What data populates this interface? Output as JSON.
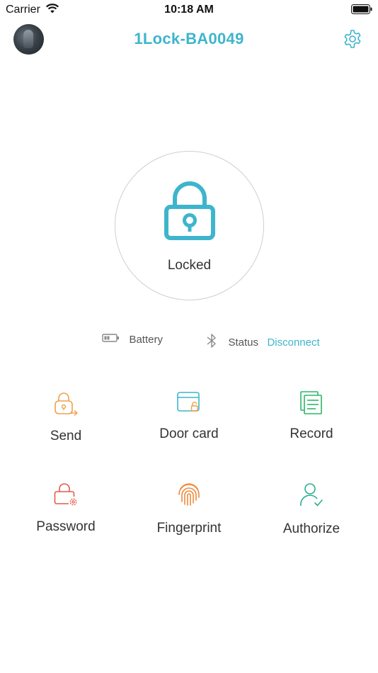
{
  "status_bar": {
    "carrier": "Carrier",
    "time": "10:18 AM"
  },
  "header": {
    "title": "1Lock-BA0049",
    "avatar_icon": "avatar-photo",
    "settings_icon": "gear-icon"
  },
  "lock": {
    "state_label": "Locked",
    "icon": "padlock-icon"
  },
  "info": {
    "battery_label": "Battery",
    "status_label": "Status",
    "status_value": "Disconnect"
  },
  "menu": [
    {
      "label": "Send",
      "icon": "send-lock-icon",
      "color": "#f0a04b"
    },
    {
      "label": "Door card",
      "icon": "door-card-icon",
      "color": "#3eb5cc"
    },
    {
      "label": "Record",
      "icon": "record-icon",
      "color": "#2cb56a"
    },
    {
      "label": "Password",
      "icon": "password-lock-icon",
      "color": "#e35a4a"
    },
    {
      "label": "Fingerprint",
      "icon": "fingerprint-icon",
      "color": "#f08a3c"
    },
    {
      "label": "Authorize",
      "icon": "authorize-user-icon",
      "color": "#2cae92"
    }
  ],
  "colors": {
    "accent": "#3eb5cc"
  }
}
